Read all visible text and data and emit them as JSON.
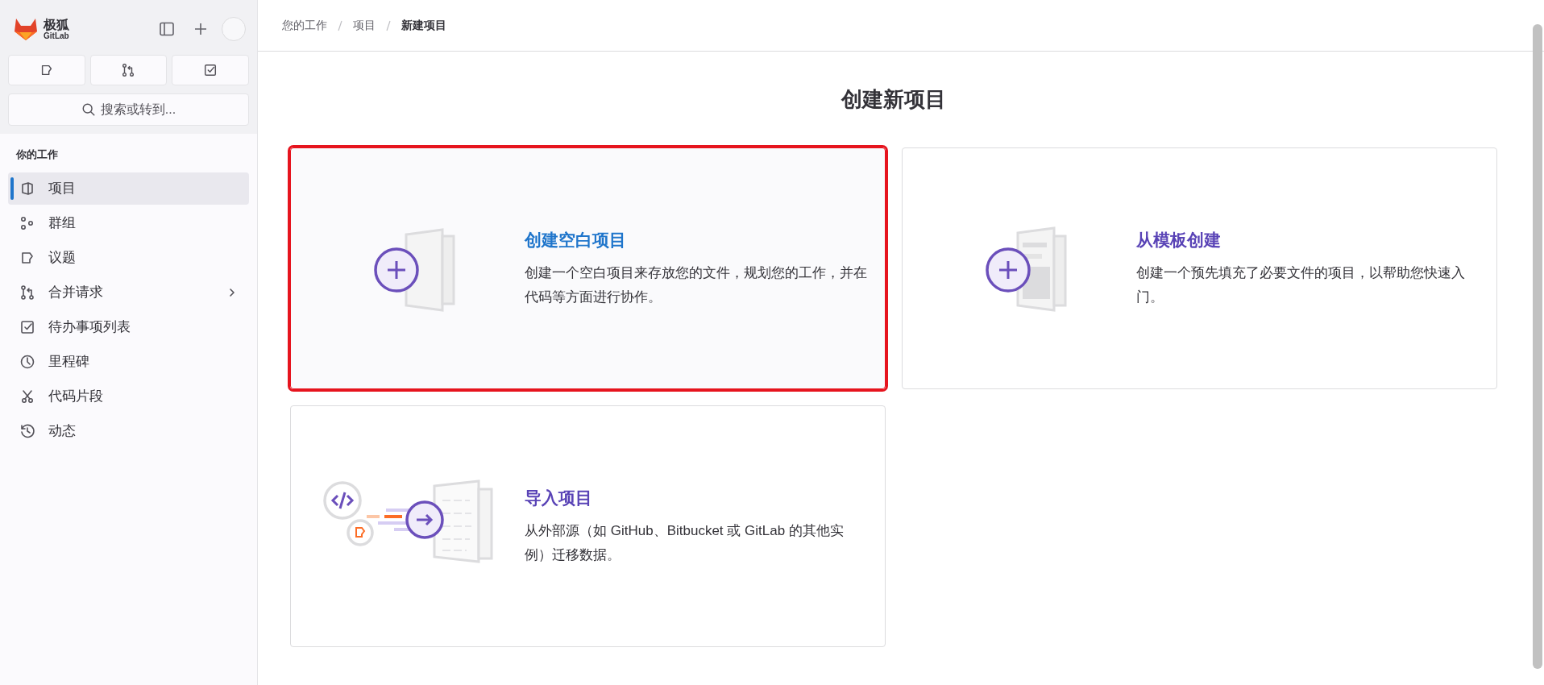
{
  "sidebar": {
    "brand": "极狐",
    "brand_sub": "GitLab",
    "quick_actions": [
      {
        "kind": "issue"
      },
      {
        "kind": "merge"
      },
      {
        "kind": "todo"
      }
    ],
    "search": {
      "placeholder": "搜索或转到..."
    },
    "section": "你的工作",
    "items": [
      {
        "label": "项目",
        "kind": "project",
        "selected": true,
        "submenu": false
      },
      {
        "label": "群组",
        "kind": "group",
        "selected": false,
        "submenu": false
      },
      {
        "label": "议题",
        "kind": "issue",
        "selected": false,
        "submenu": false
      },
      {
        "label": "合并请求",
        "kind": "merge",
        "selected": false,
        "submenu": true
      },
      {
        "label": "待办事项列表",
        "kind": "todo",
        "selected": false,
        "submenu": false
      },
      {
        "label": "里程碑",
        "kind": "clock",
        "selected": false,
        "submenu": false
      },
      {
        "label": "代码片段",
        "kind": "scissors",
        "selected": false,
        "submenu": false
      },
      {
        "label": "动态",
        "kind": "history",
        "selected": false,
        "submenu": false
      }
    ]
  },
  "breadcrumbs": [
    {
      "label": "您的工作",
      "current": false
    },
    {
      "label": "项目",
      "current": false
    },
    {
      "label": "新建项目",
      "current": true
    }
  ],
  "heading": "创建新项目",
  "cards": [
    {
      "kind": "blank",
      "title": "创建空白项目",
      "description": "创建一个空白项目来存放您的文件，规划您的工作，并在代码等方面进行协作。",
      "hovered": true,
      "highlighted": true
    },
    {
      "kind": "template",
      "title": "从模板创建",
      "description": "创建一个预先填充了必要文件的项目，以帮助您快速入门。",
      "hovered": false,
      "highlighted": false
    },
    {
      "kind": "import",
      "title": "导入项目",
      "description": "从外部源（如 GitHub、Bitbucket 或 GitLab 的其他实例）迁移数据。",
      "hovered": false,
      "highlighted": false
    }
  ]
}
